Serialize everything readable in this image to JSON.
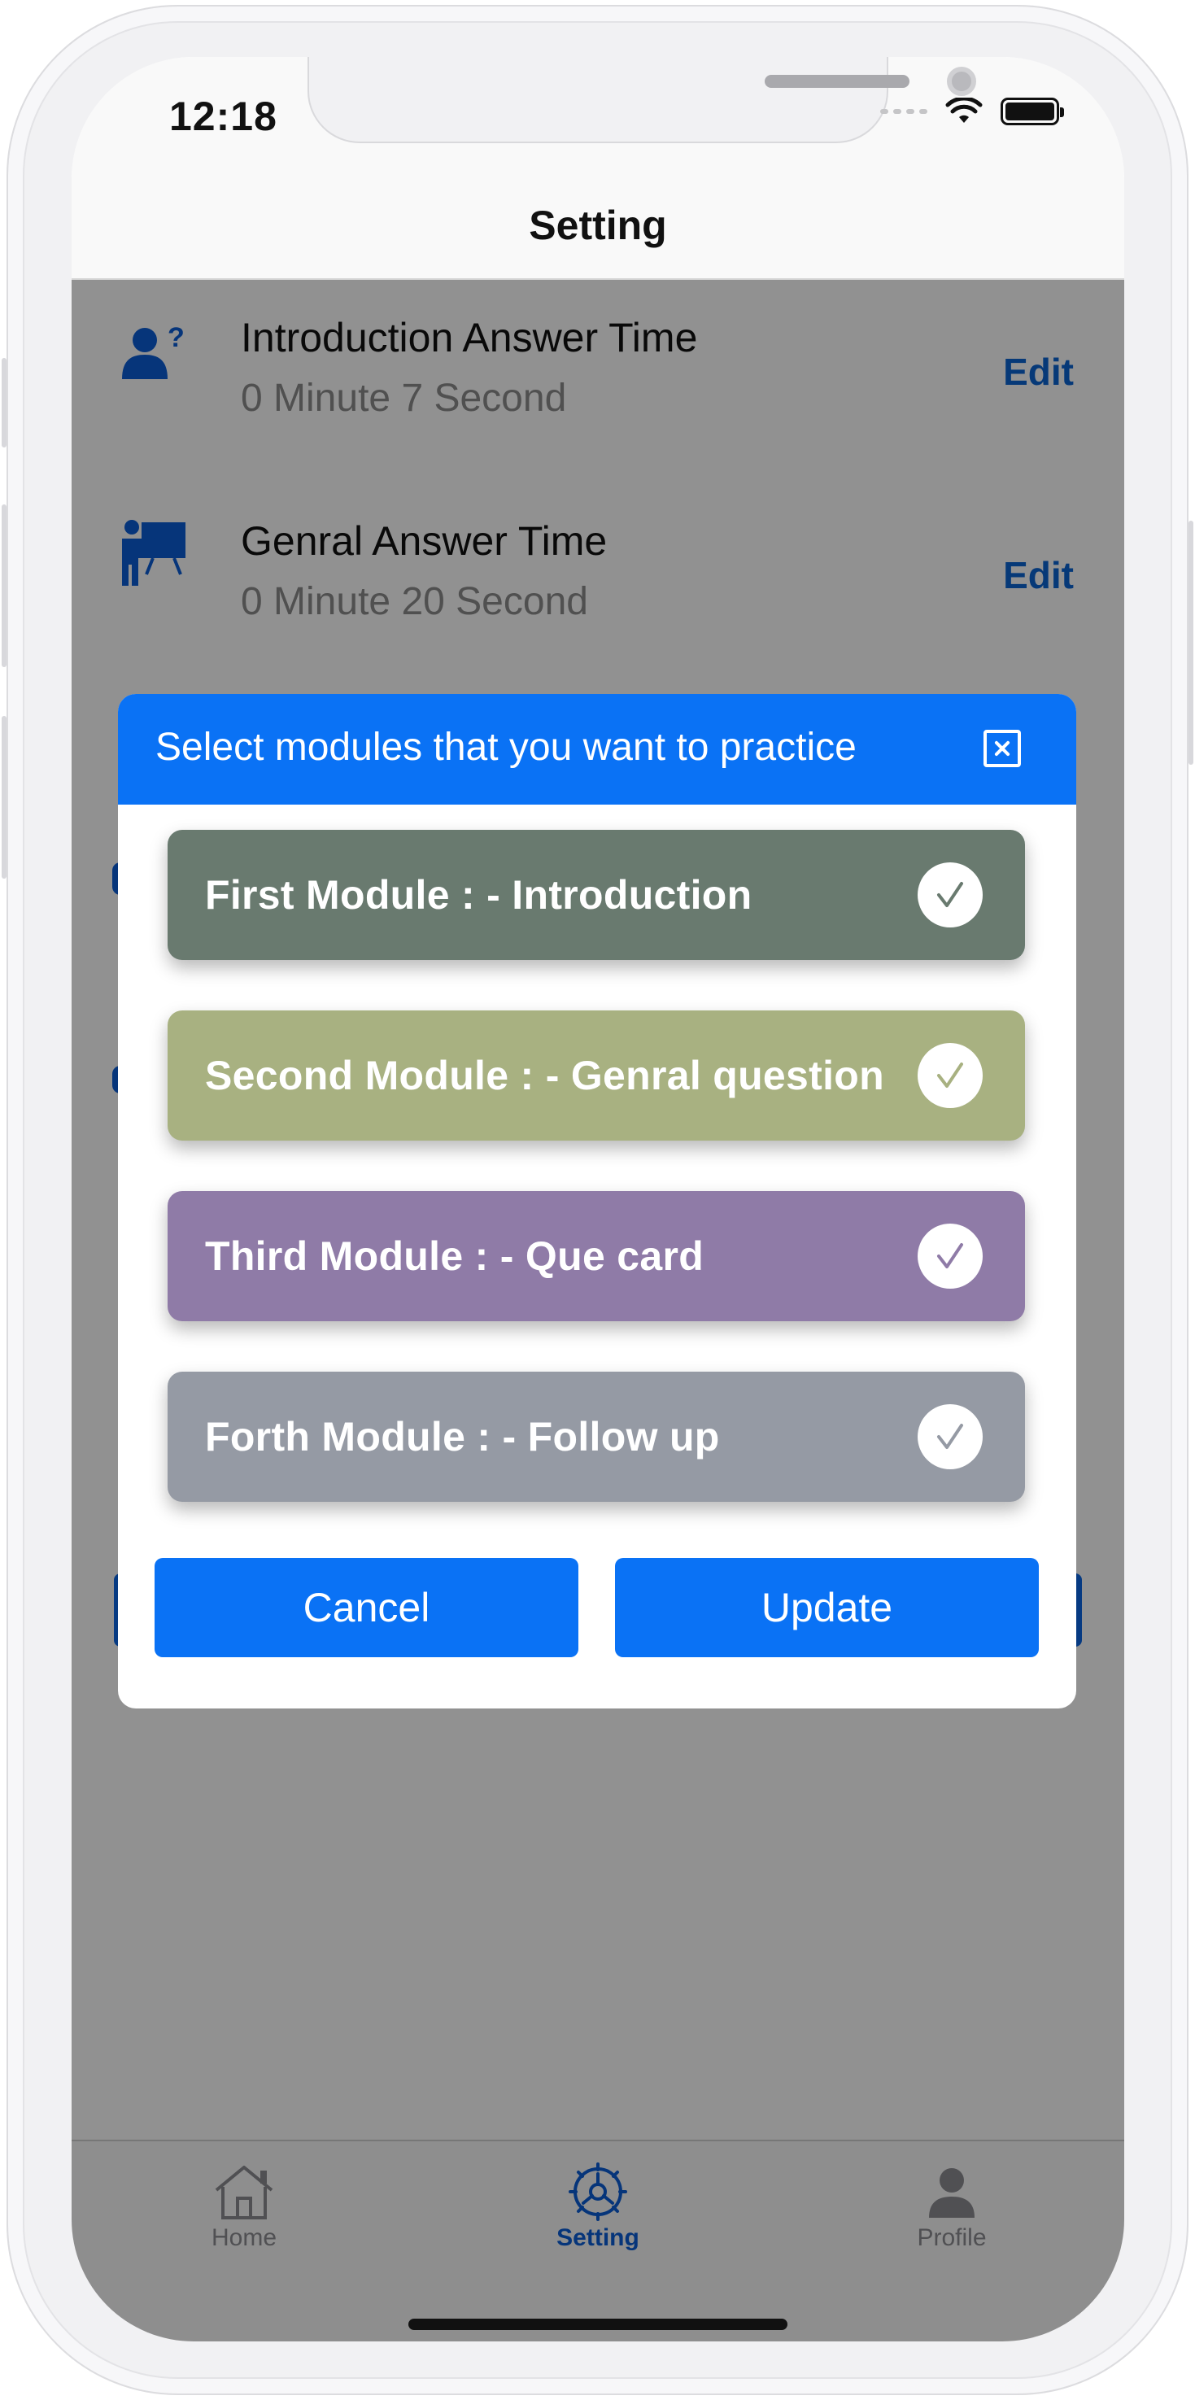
{
  "status_bar": {
    "time": "12:18"
  },
  "nav": {
    "title": "Setting"
  },
  "settings": {
    "rows": [
      {
        "title": "Introduction Answer Time",
        "value": "0 Minute 7 Second",
        "edit_label": "Edit",
        "icon": "user-question-icon"
      },
      {
        "title": "Genral Answer Time",
        "value": "0 Minute 20 Second",
        "edit_label": "Edit",
        "icon": "teacher-board-icon"
      }
    ]
  },
  "modal": {
    "title": "Select modules that you want to practice",
    "close_icon": "close-icon",
    "modules": [
      {
        "label": "First Module : - Introduction",
        "color": "#697A6F",
        "checked": true
      },
      {
        "label": "Second Module : - Genral question",
        "color": "#A8B181",
        "checked": true
      },
      {
        "label": "Third Module : - Que card",
        "color": "#8F7BA7",
        "checked": true
      },
      {
        "label": "Forth Module : - Follow up",
        "color": "#959AA4",
        "checked": true
      }
    ],
    "cancel_label": "Cancel",
    "update_label": "Update"
  },
  "tab_bar": {
    "tabs": [
      {
        "label": "Home",
        "icon": "home-icon",
        "active": false
      },
      {
        "label": "Setting",
        "icon": "gear-icon",
        "active": true
      },
      {
        "label": "Profile",
        "icon": "person-icon",
        "active": false
      }
    ]
  },
  "colors": {
    "accent": "#0A72F5",
    "link": "#0B64D4",
    "overlay": "rgba(0,0,0,0.43)"
  }
}
